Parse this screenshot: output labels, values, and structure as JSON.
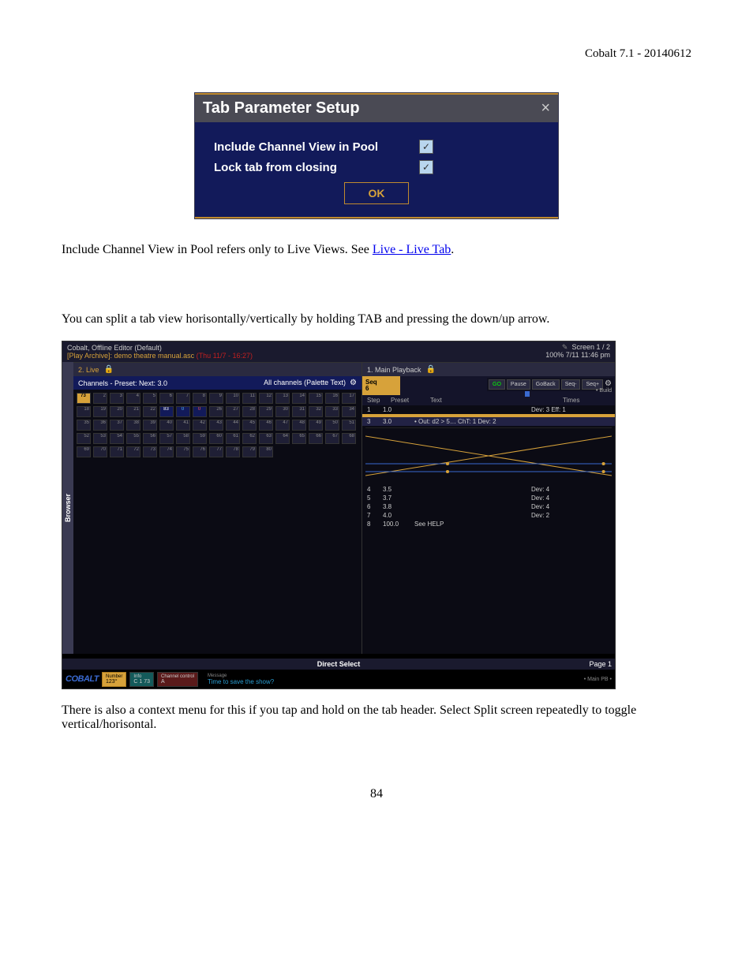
{
  "header": {
    "right": "Cobalt 7.1 - 20140612"
  },
  "dialog": {
    "title": "Tab Parameter Setup",
    "row1": "Include Channel View in Pool",
    "row2": "Lock tab from closing",
    "ok": "OK"
  },
  "para1_pre": "Include Channel View in Pool refers only to Live Views. See ",
  "para1_link": "Live - Live Tab",
  "para1_post": ".",
  "para2": "You can split a tab view horisontally/vertically by holding TAB and pressing the down/up arrow.",
  "para3": "There is also a context menu for this if you tap and hold on the tab header. Select Split screen repeatedly to toggle vertical/horisontal.",
  "page_number": "84",
  "app": {
    "title1": "Cobalt, Offline Editor (Default)",
    "title2": "[Play Archive]: demo theatre manual.asc",
    "title2_suffix": "(Thu 11/7 - 16:27)",
    "screen": "Screen 1 / 2",
    "zoom_time": "100%   7/11 11:46 pm",
    "browser": "Browser",
    "left_tab": "2. Live",
    "chan_left": "Channels - Preset:   Next: 3.0",
    "chan_right": "All channels (Palette Text)",
    "val73": "73",
    "val83": "83",
    "right_tab": "1. Main Playback",
    "seq_a": "Seq",
    "seq_b": "6",
    "buttons": {
      "go": "GO",
      "pause": "Pause",
      "goback": "GoBack",
      "seqm": "Seq-",
      "seqp": "Seq+",
      "build": "• Build"
    },
    "cuehdr": {
      "step": "Step",
      "preset": "Preset",
      "text": "Text",
      "times": "Times"
    },
    "cues": [
      {
        "n": "1",
        "p": "1.0",
        "t": "",
        "r": "Dev: 3   Eff: 1"
      },
      {
        "n": "3",
        "p": "3.0",
        "t": "• Out: d2 > 5…   ChT: 1   Dev: 2",
        "r": ""
      },
      {
        "n": "4",
        "p": "3.5",
        "t": "",
        "r": "Dev: 4"
      },
      {
        "n": "5",
        "p": "3.7",
        "t": "",
        "r": "Dev: 4"
      },
      {
        "n": "6",
        "p": "3.8",
        "t": "",
        "r": "Dev: 4"
      },
      {
        "n": "7",
        "p": "4.0",
        "t": "",
        "r": "Dev: 2"
      },
      {
        "n": "8",
        "p": "100.0",
        "t": "See HELP",
        "r": ""
      }
    ],
    "ds": "Direct Select",
    "ds_page": "Page 1",
    "footer": {
      "logo": "COBALT",
      "number_lbl": "Number",
      "number": "123°",
      "info_lbl": "Info",
      "info": "C  1 73",
      "chctl_lbl": "Channel control",
      "chctl": "A",
      "msg_lbl": "Message",
      "msg": "Time to save the show?",
      "main_pb": "• Main PB   •"
    }
  }
}
